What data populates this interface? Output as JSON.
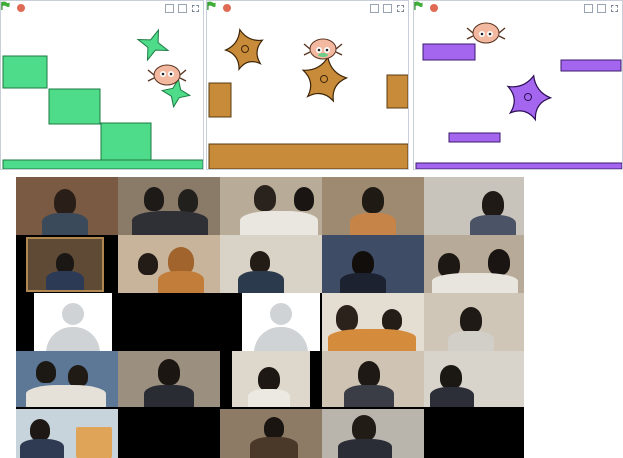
{
  "stages": [
    {
      "name": "stage-1",
      "accent": "#4fdc8a"
    },
    {
      "name": "stage-2",
      "accent": "#c88b3a"
    },
    {
      "name": "stage-3",
      "accent": "#a466ee"
    }
  ],
  "icons": {
    "flag": "green-flag-icon",
    "stop": "stop-icon",
    "small_stage": "small-stage-icon",
    "large_stage": "large-stage-icon",
    "fullscreen": "fullscreen-icon"
  },
  "colors": {
    "flag_green": "#3faf3a",
    "stop_red": "#e06b55",
    "sprite_green": "#4fdc8a",
    "sprite_brown": "#c88b3a",
    "sprite_purple": "#a466ee"
  },
  "video_grid": {
    "rows": 5,
    "columns": 5,
    "avatar_placeholder_count": 2
  }
}
